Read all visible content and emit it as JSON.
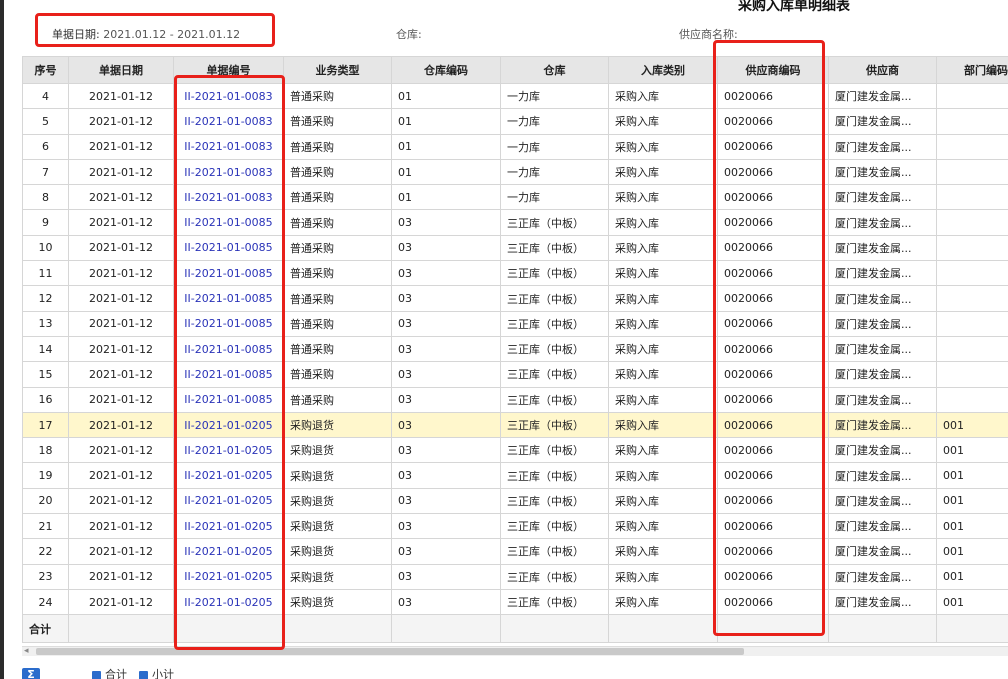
{
  "report": {
    "title": "采购入库单明细表",
    "filters": {
      "date_label": "单据日期:",
      "date_value": "2021.01.12 - 2021.01.12",
      "warehouse_label": "仓库:",
      "supplier_label": "供应商名称:"
    }
  },
  "table": {
    "columns": [
      "序号",
      "单据日期",
      "单据编号",
      "业务类型",
      "仓库编码",
      "仓库",
      "入库类别",
      "供应商编码",
      "供应商",
      "部门编码"
    ],
    "rows": [
      [
        "4",
        "2021-01-12",
        "II-2021-01-0083",
        "普通采购",
        "01",
        "一力库",
        "采购入库",
        "0020066",
        "厦门建发金属...",
        ""
      ],
      [
        "5",
        "2021-01-12",
        "II-2021-01-0083",
        "普通采购",
        "01",
        "一力库",
        "采购入库",
        "0020066",
        "厦门建发金属...",
        ""
      ],
      [
        "6",
        "2021-01-12",
        "II-2021-01-0083",
        "普通采购",
        "01",
        "一力库",
        "采购入库",
        "0020066",
        "厦门建发金属...",
        ""
      ],
      [
        "7",
        "2021-01-12",
        "II-2021-01-0083",
        "普通采购",
        "01",
        "一力库",
        "采购入库",
        "0020066",
        "厦门建发金属...",
        ""
      ],
      [
        "8",
        "2021-01-12",
        "II-2021-01-0083",
        "普通采购",
        "01",
        "一力库",
        "采购入库",
        "0020066",
        "厦门建发金属...",
        ""
      ],
      [
        "9",
        "2021-01-12",
        "II-2021-01-0085",
        "普通采购",
        "03",
        "三正库（中板）",
        "采购入库",
        "0020066",
        "厦门建发金属...",
        ""
      ],
      [
        "10",
        "2021-01-12",
        "II-2021-01-0085",
        "普通采购",
        "03",
        "三正库（中板）",
        "采购入库",
        "0020066",
        "厦门建发金属...",
        ""
      ],
      [
        "11",
        "2021-01-12",
        "II-2021-01-0085",
        "普通采购",
        "03",
        "三正库（中板）",
        "采购入库",
        "0020066",
        "厦门建发金属...",
        ""
      ],
      [
        "12",
        "2021-01-12",
        "II-2021-01-0085",
        "普通采购",
        "03",
        "三正库（中板）",
        "采购入库",
        "0020066",
        "厦门建发金属...",
        ""
      ],
      [
        "13",
        "2021-01-12",
        "II-2021-01-0085",
        "普通采购",
        "03",
        "三正库（中板）",
        "采购入库",
        "0020066",
        "厦门建发金属...",
        ""
      ],
      [
        "14",
        "2021-01-12",
        "II-2021-01-0085",
        "普通采购",
        "03",
        "三正库（中板）",
        "采购入库",
        "0020066",
        "厦门建发金属...",
        ""
      ],
      [
        "15",
        "2021-01-12",
        "II-2021-01-0085",
        "普通采购",
        "03",
        "三正库（中板）",
        "采购入库",
        "0020066",
        "厦门建发金属...",
        ""
      ],
      [
        "16",
        "2021-01-12",
        "II-2021-01-0085",
        "普通采购",
        "03",
        "三正库（中板）",
        "采购入库",
        "0020066",
        "厦门建发金属...",
        ""
      ],
      [
        "17",
        "2021-01-12",
        "II-2021-01-0205",
        "采购退货",
        "03",
        "三正库（中板）",
        "采购入库",
        "0020066",
        "厦门建发金属...",
        "001"
      ],
      [
        "18",
        "2021-01-12",
        "II-2021-01-0205",
        "采购退货",
        "03",
        "三正库（中板）",
        "采购入库",
        "0020066",
        "厦门建发金属...",
        "001"
      ],
      [
        "19",
        "2021-01-12",
        "II-2021-01-0205",
        "采购退货",
        "03",
        "三正库（中板）",
        "采购入库",
        "0020066",
        "厦门建发金属...",
        "001"
      ],
      [
        "20",
        "2021-01-12",
        "II-2021-01-0205",
        "采购退货",
        "03",
        "三正库（中板）",
        "采购入库",
        "0020066",
        "厦门建发金属...",
        "001"
      ],
      [
        "21",
        "2021-01-12",
        "II-2021-01-0205",
        "采购退货",
        "03",
        "三正库（中板）",
        "采购入库",
        "0020066",
        "厦门建发金属...",
        "001"
      ],
      [
        "22",
        "2021-01-12",
        "II-2021-01-0205",
        "采购退货",
        "03",
        "三正库（中板）",
        "采购入库",
        "0020066",
        "厦门建发金属...",
        "001"
      ],
      [
        "23",
        "2021-01-12",
        "II-2021-01-0205",
        "采购退货",
        "03",
        "三正库（中板）",
        "采购入库",
        "0020066",
        "厦门建发金属...",
        "001"
      ],
      [
        "24",
        "2021-01-12",
        "II-2021-01-0205",
        "采购退货",
        "03",
        "三正库（中板）",
        "采购入库",
        "0020066",
        "厦门建发金属...",
        "001"
      ]
    ],
    "highlighted_row": 13,
    "total_label": "合计"
  },
  "footer": {
    "button_label": "Σ",
    "options": [
      "合计",
      "小计"
    ]
  },
  "colors": {
    "highlight_box": "#e8201a",
    "link": "#2a33b8",
    "row_highlight": "#fff7cc",
    "header_bg": "#e6e6e6"
  }
}
